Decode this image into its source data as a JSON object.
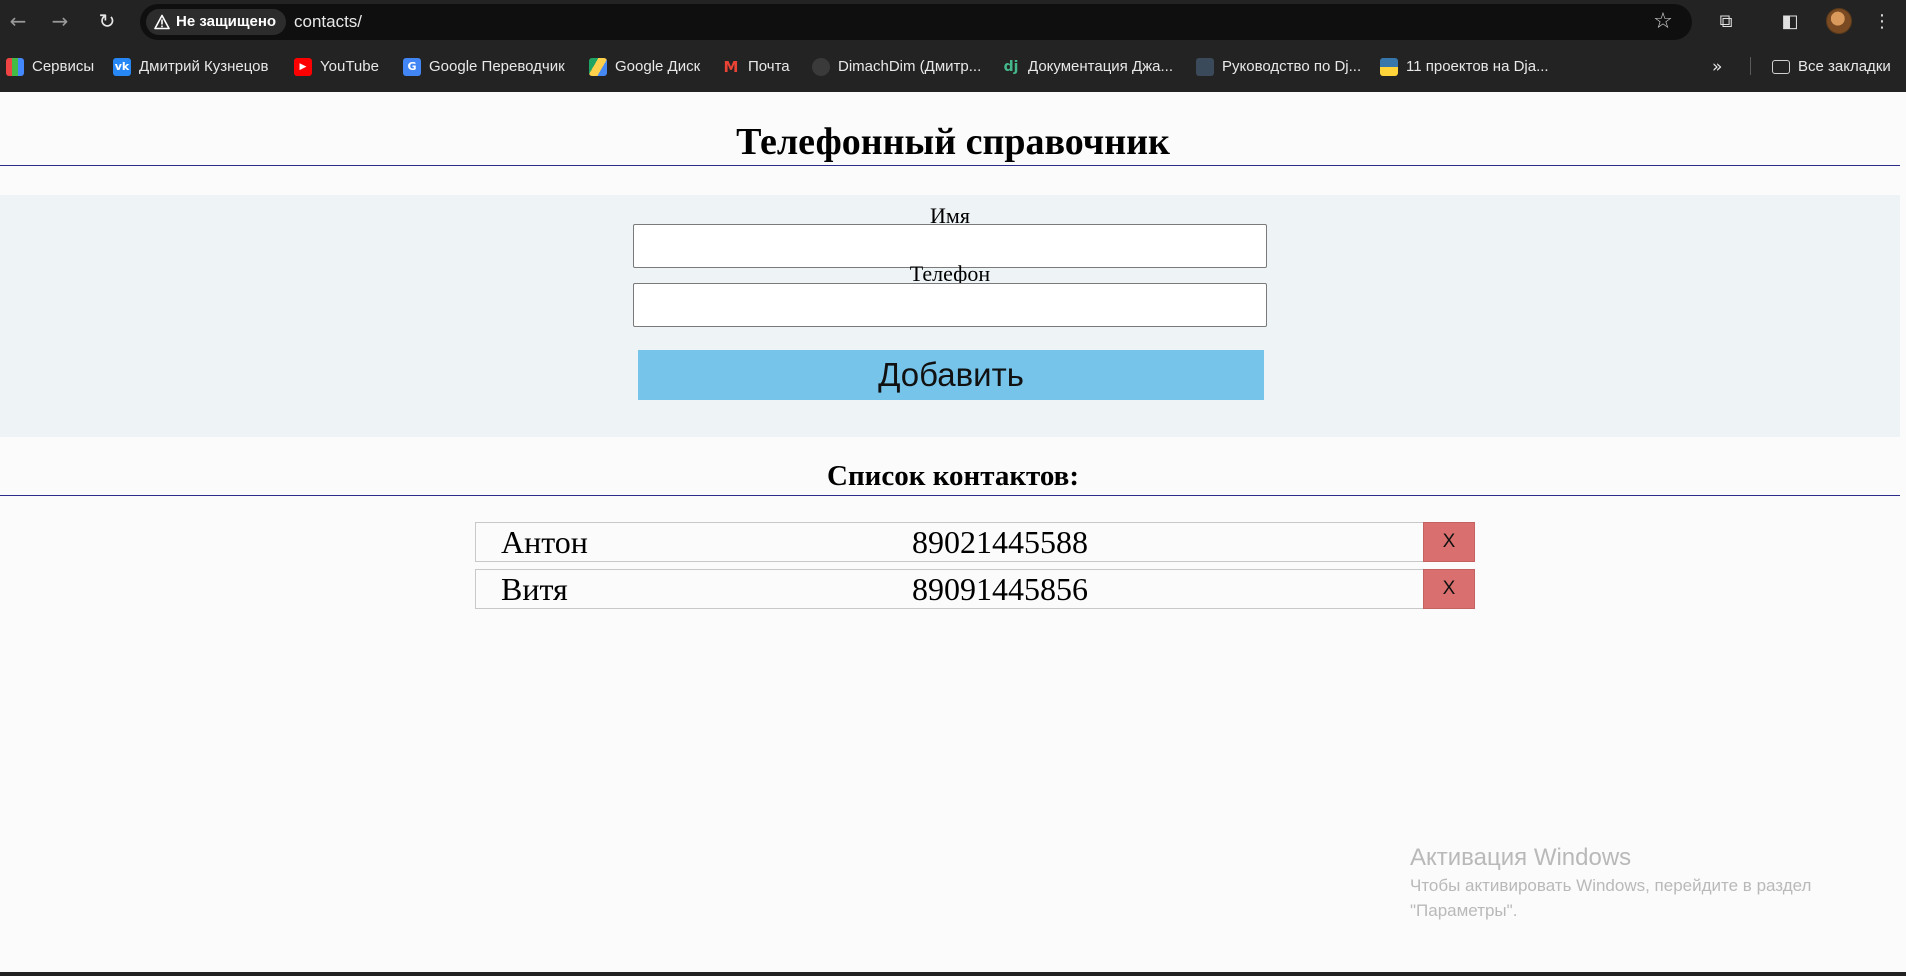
{
  "browser": {
    "security_label": "Не защищено",
    "url": "contacts/",
    "icons": {
      "back": "back-arrow-icon",
      "forward": "forward-arrow-icon",
      "reload": "reload-icon",
      "star": "star-icon",
      "extensions": "extensions-icon",
      "sidebar": "sidebar-icon",
      "menu": "kebab-menu-icon"
    }
  },
  "bookmarks": {
    "items": [
      {
        "label": "Сервисы",
        "icon": "apps-grid-icon"
      },
      {
        "label": "Дмитрий Кузнецов",
        "icon": "vk-icon"
      },
      {
        "label": "YouTube",
        "icon": "youtube-icon"
      },
      {
        "label": "Google Переводчик",
        "icon": "google-translate-icon"
      },
      {
        "label": "Google Диск",
        "icon": "google-drive-icon"
      },
      {
        "label": "Почта",
        "icon": "gmail-icon"
      },
      {
        "label": "DimachDim (Дмитр...",
        "icon": "github-icon"
      },
      {
        "label": "Документация Джа...",
        "icon": "django-icon"
      },
      {
        "label": "Руководство по Dj...",
        "icon": "page-icon"
      },
      {
        "label": "11 проектов на Dja...",
        "icon": "python-icon"
      }
    ],
    "overflow_icon": "chevron-double-right-icon",
    "all_bookmarks": "Все закладки"
  },
  "page": {
    "title": "Телефонный справочник",
    "form": {
      "name_label": "Имя",
      "name_value": "",
      "phone_label": "Телефон",
      "phone_value": "",
      "add_button": "Добавить"
    },
    "list_title": "Список контактов:",
    "contacts": [
      {
        "name": "Антон",
        "phone": "89021445588",
        "delete": "X"
      },
      {
        "name": "Витя",
        "phone": "89091445856",
        "delete": "X"
      }
    ]
  },
  "watermark": {
    "title": "Активация Windows",
    "line1": "Чтобы активировать Windows, перейдите в раздел",
    "line2": "\"Параметры\"."
  },
  "colors": {
    "chrome": "#232323",
    "form_band": "#eef3f5",
    "add_button": "#77c4ea",
    "delete_button": "#d9706f",
    "rule": "#2c2c8a"
  }
}
